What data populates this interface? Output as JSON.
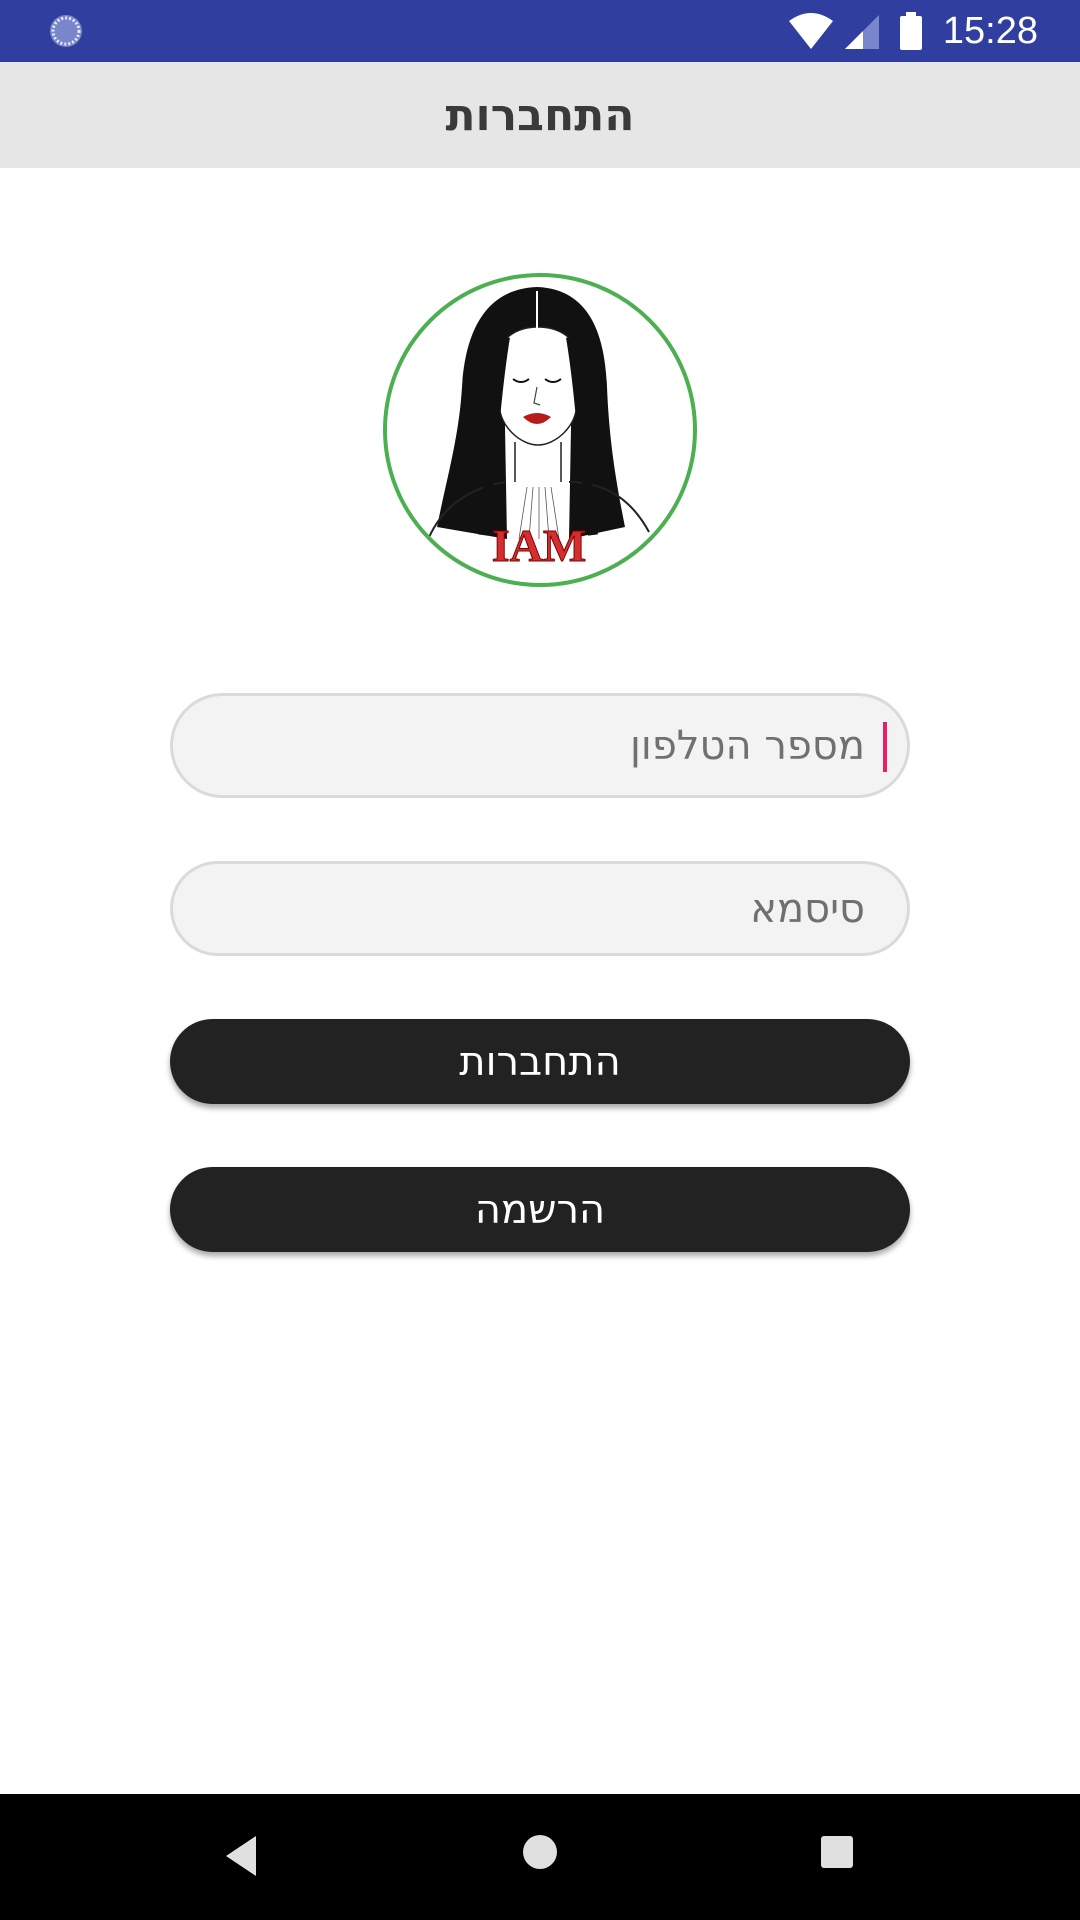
{
  "status_bar": {
    "time": "15:28",
    "icons": [
      "loading-spinner-icon",
      "wifi-icon",
      "cell-signal-icon",
      "battery-icon"
    ],
    "background_color": "#303f9f"
  },
  "toolbar": {
    "title": "התחברות",
    "background_color": "#e6e6e6"
  },
  "logo": {
    "text": "IAM",
    "ring_color": "#4caf50"
  },
  "form": {
    "phone": {
      "placeholder": "מספר הטלפון",
      "value": ""
    },
    "password": {
      "placeholder": "סיסמא",
      "value": ""
    },
    "login_label": "התחברות",
    "register_label": "הרשמה",
    "button_color": "#222222",
    "caret_color": "#e91e63"
  },
  "nav_bar": {
    "icons": [
      "back-icon",
      "home-icon",
      "recents-icon"
    ]
  }
}
